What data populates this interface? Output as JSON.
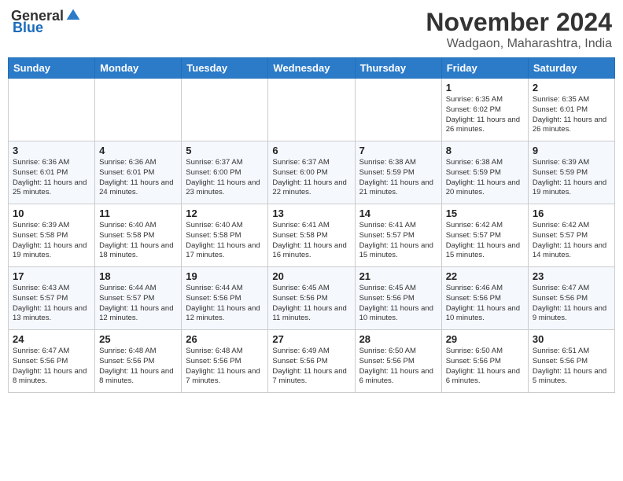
{
  "header": {
    "logo_general": "General",
    "logo_blue": "Blue",
    "month_title": "November 2024",
    "location": "Wadgaon, Maharashtra, India"
  },
  "weekdays": [
    "Sunday",
    "Monday",
    "Tuesday",
    "Wednesday",
    "Thursday",
    "Friday",
    "Saturday"
  ],
  "weeks": [
    [
      {
        "day": "",
        "info": ""
      },
      {
        "day": "",
        "info": ""
      },
      {
        "day": "",
        "info": ""
      },
      {
        "day": "",
        "info": ""
      },
      {
        "day": "",
        "info": ""
      },
      {
        "day": "1",
        "info": "Sunrise: 6:35 AM\nSunset: 6:02 PM\nDaylight: 11 hours and 26 minutes."
      },
      {
        "day": "2",
        "info": "Sunrise: 6:35 AM\nSunset: 6:01 PM\nDaylight: 11 hours and 26 minutes."
      }
    ],
    [
      {
        "day": "3",
        "info": "Sunrise: 6:36 AM\nSunset: 6:01 PM\nDaylight: 11 hours and 25 minutes."
      },
      {
        "day": "4",
        "info": "Sunrise: 6:36 AM\nSunset: 6:01 PM\nDaylight: 11 hours and 24 minutes."
      },
      {
        "day": "5",
        "info": "Sunrise: 6:37 AM\nSunset: 6:00 PM\nDaylight: 11 hours and 23 minutes."
      },
      {
        "day": "6",
        "info": "Sunrise: 6:37 AM\nSunset: 6:00 PM\nDaylight: 11 hours and 22 minutes."
      },
      {
        "day": "7",
        "info": "Sunrise: 6:38 AM\nSunset: 5:59 PM\nDaylight: 11 hours and 21 minutes."
      },
      {
        "day": "8",
        "info": "Sunrise: 6:38 AM\nSunset: 5:59 PM\nDaylight: 11 hours and 20 minutes."
      },
      {
        "day": "9",
        "info": "Sunrise: 6:39 AM\nSunset: 5:59 PM\nDaylight: 11 hours and 19 minutes."
      }
    ],
    [
      {
        "day": "10",
        "info": "Sunrise: 6:39 AM\nSunset: 5:58 PM\nDaylight: 11 hours and 19 minutes."
      },
      {
        "day": "11",
        "info": "Sunrise: 6:40 AM\nSunset: 5:58 PM\nDaylight: 11 hours and 18 minutes."
      },
      {
        "day": "12",
        "info": "Sunrise: 6:40 AM\nSunset: 5:58 PM\nDaylight: 11 hours and 17 minutes."
      },
      {
        "day": "13",
        "info": "Sunrise: 6:41 AM\nSunset: 5:58 PM\nDaylight: 11 hours and 16 minutes."
      },
      {
        "day": "14",
        "info": "Sunrise: 6:41 AM\nSunset: 5:57 PM\nDaylight: 11 hours and 15 minutes."
      },
      {
        "day": "15",
        "info": "Sunrise: 6:42 AM\nSunset: 5:57 PM\nDaylight: 11 hours and 15 minutes."
      },
      {
        "day": "16",
        "info": "Sunrise: 6:42 AM\nSunset: 5:57 PM\nDaylight: 11 hours and 14 minutes."
      }
    ],
    [
      {
        "day": "17",
        "info": "Sunrise: 6:43 AM\nSunset: 5:57 PM\nDaylight: 11 hours and 13 minutes."
      },
      {
        "day": "18",
        "info": "Sunrise: 6:44 AM\nSunset: 5:57 PM\nDaylight: 11 hours and 12 minutes."
      },
      {
        "day": "19",
        "info": "Sunrise: 6:44 AM\nSunset: 5:56 PM\nDaylight: 11 hours and 12 minutes."
      },
      {
        "day": "20",
        "info": "Sunrise: 6:45 AM\nSunset: 5:56 PM\nDaylight: 11 hours and 11 minutes."
      },
      {
        "day": "21",
        "info": "Sunrise: 6:45 AM\nSunset: 5:56 PM\nDaylight: 11 hours and 10 minutes."
      },
      {
        "day": "22",
        "info": "Sunrise: 6:46 AM\nSunset: 5:56 PM\nDaylight: 11 hours and 10 minutes."
      },
      {
        "day": "23",
        "info": "Sunrise: 6:47 AM\nSunset: 5:56 PM\nDaylight: 11 hours and 9 minutes."
      }
    ],
    [
      {
        "day": "24",
        "info": "Sunrise: 6:47 AM\nSunset: 5:56 PM\nDaylight: 11 hours and 8 minutes."
      },
      {
        "day": "25",
        "info": "Sunrise: 6:48 AM\nSunset: 5:56 PM\nDaylight: 11 hours and 8 minutes."
      },
      {
        "day": "26",
        "info": "Sunrise: 6:48 AM\nSunset: 5:56 PM\nDaylight: 11 hours and 7 minutes."
      },
      {
        "day": "27",
        "info": "Sunrise: 6:49 AM\nSunset: 5:56 PM\nDaylight: 11 hours and 7 minutes."
      },
      {
        "day": "28",
        "info": "Sunrise: 6:50 AM\nSunset: 5:56 PM\nDaylight: 11 hours and 6 minutes."
      },
      {
        "day": "29",
        "info": "Sunrise: 6:50 AM\nSunset: 5:56 PM\nDaylight: 11 hours and 6 minutes."
      },
      {
        "day": "30",
        "info": "Sunrise: 6:51 AM\nSunset: 5:56 PM\nDaylight: 11 hours and 5 minutes."
      }
    ]
  ]
}
